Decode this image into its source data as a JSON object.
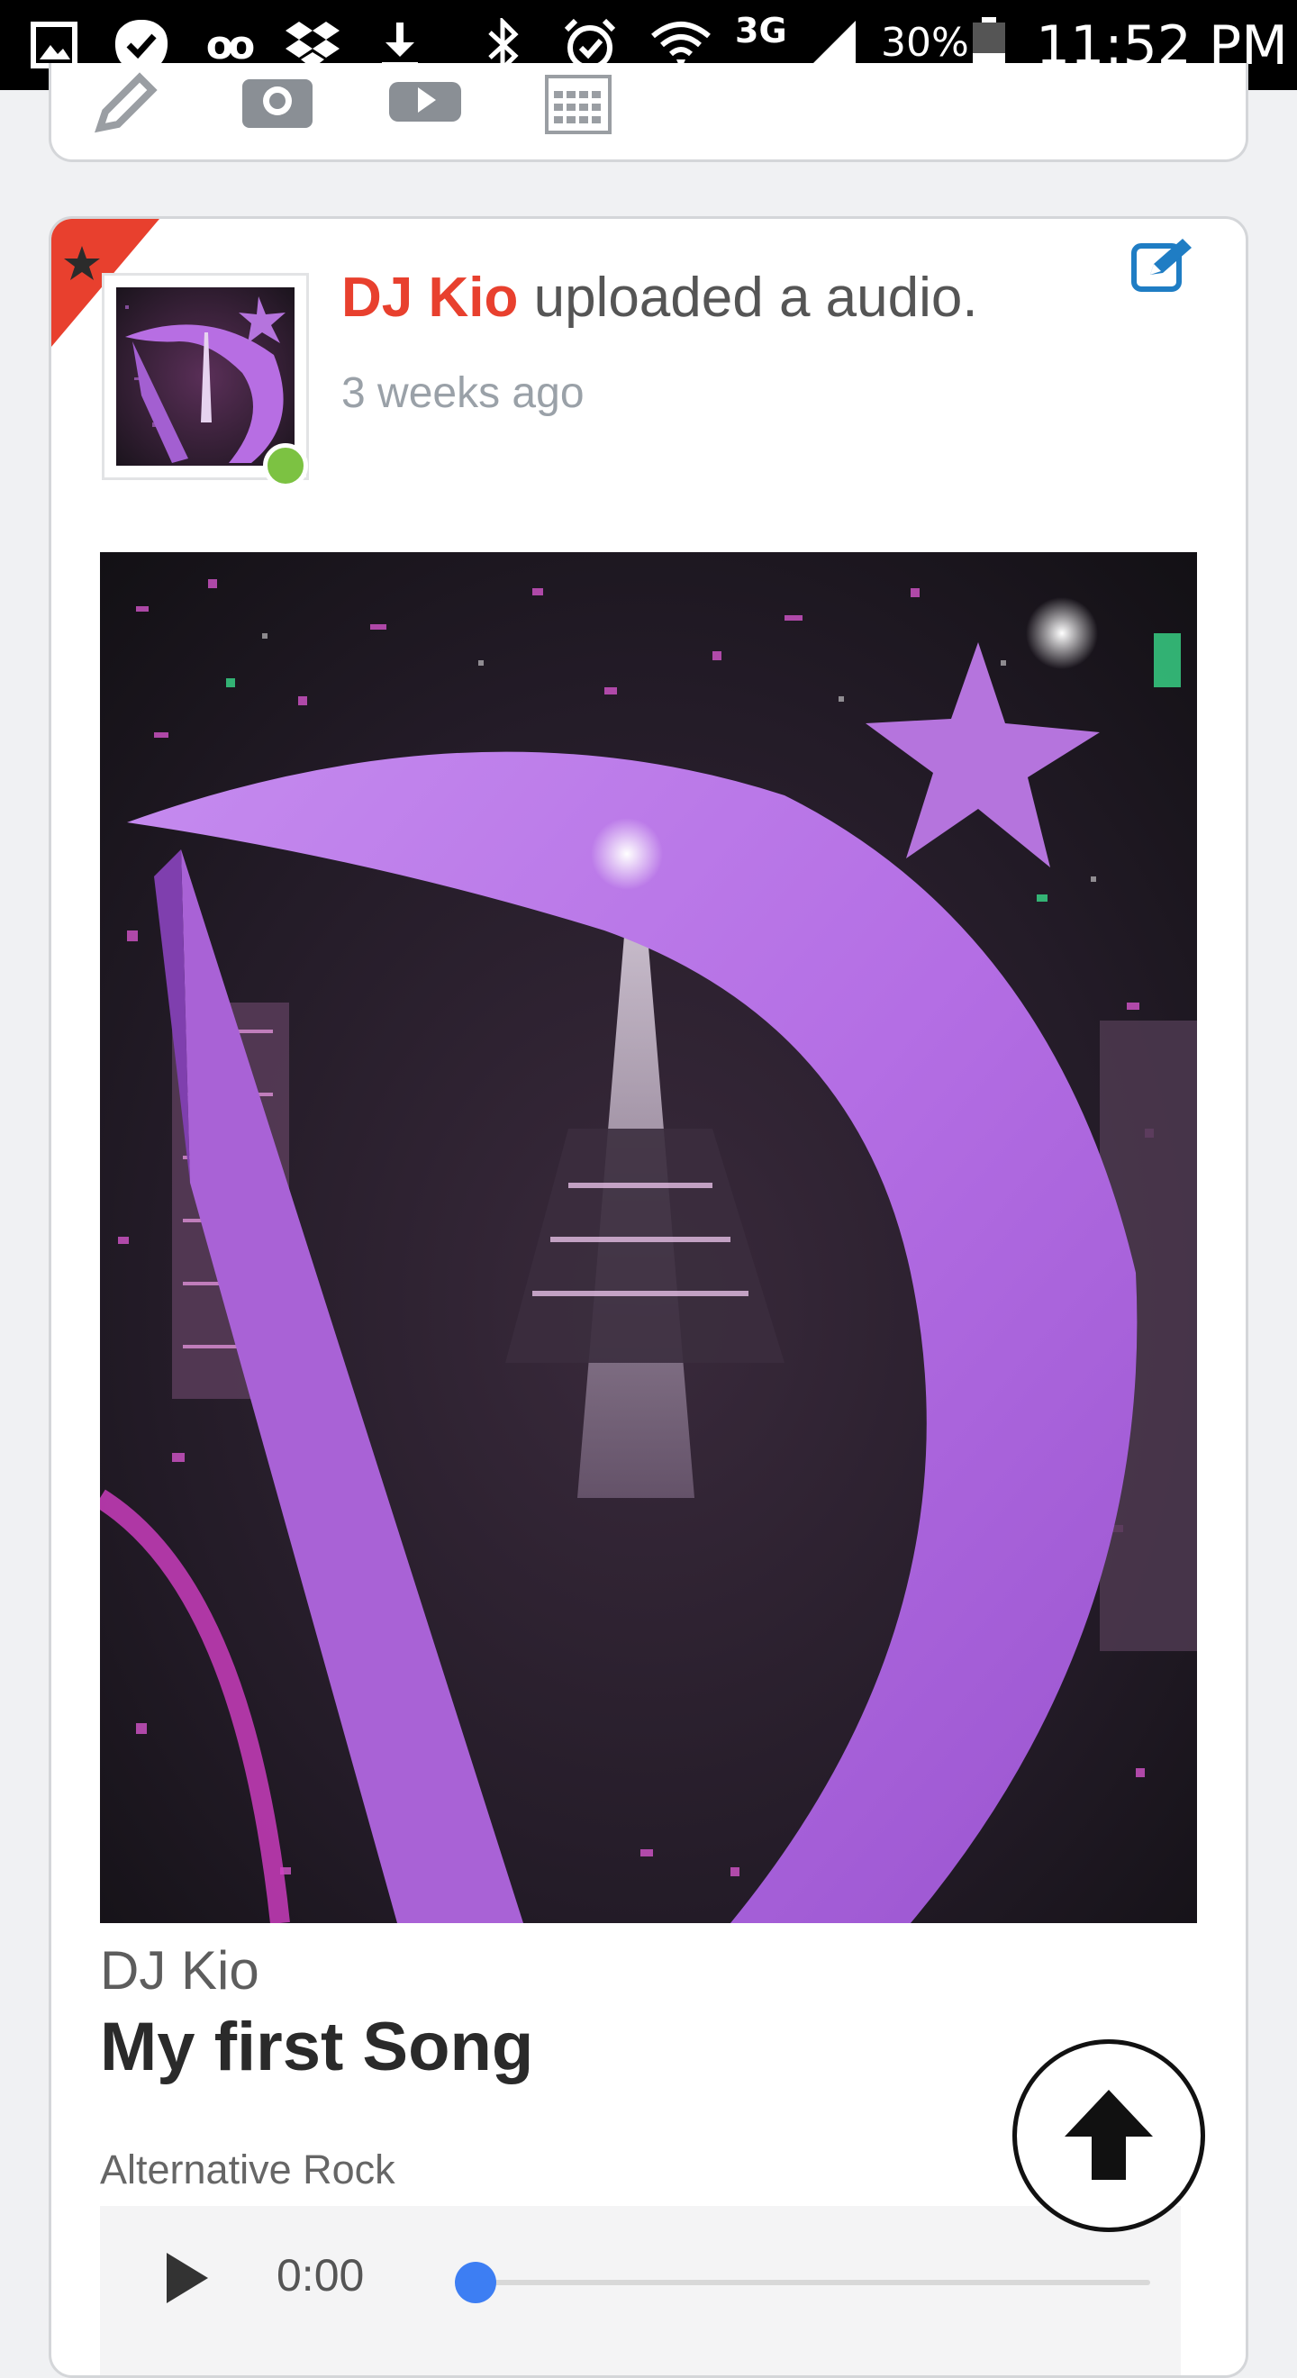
{
  "status_bar": {
    "voicemail_glyph": "oo",
    "network_type": "3G",
    "battery_percent": "30%",
    "time": "11:52 PM",
    "icons": [
      "gallery-icon",
      "check-badge-icon",
      "voicemail-icon",
      "dropbox-icon",
      "download-icon",
      "bluetooth-icon",
      "alarm-icon",
      "wifi-icon",
      "signal-icon",
      "battery-icon"
    ]
  },
  "composer": {
    "icons": [
      "pencil-icon",
      "camera-icon",
      "video-icon",
      "calendar-icon"
    ]
  },
  "post": {
    "author": "DJ Kio",
    "action_text": " uploaded a audio.",
    "time_ago": "3 weeks ago",
    "online": true,
    "featured": true
  },
  "audio": {
    "artist": "DJ Kio",
    "title": "My first Song",
    "genre": "Alternative Rock",
    "current_time": "0:00",
    "progress": 0
  },
  "colors": {
    "accent_red": "#e8402e",
    "online_green": "#7cc242",
    "player_blue": "#3d7ef3",
    "edit_blue": "#1f7dc4"
  }
}
